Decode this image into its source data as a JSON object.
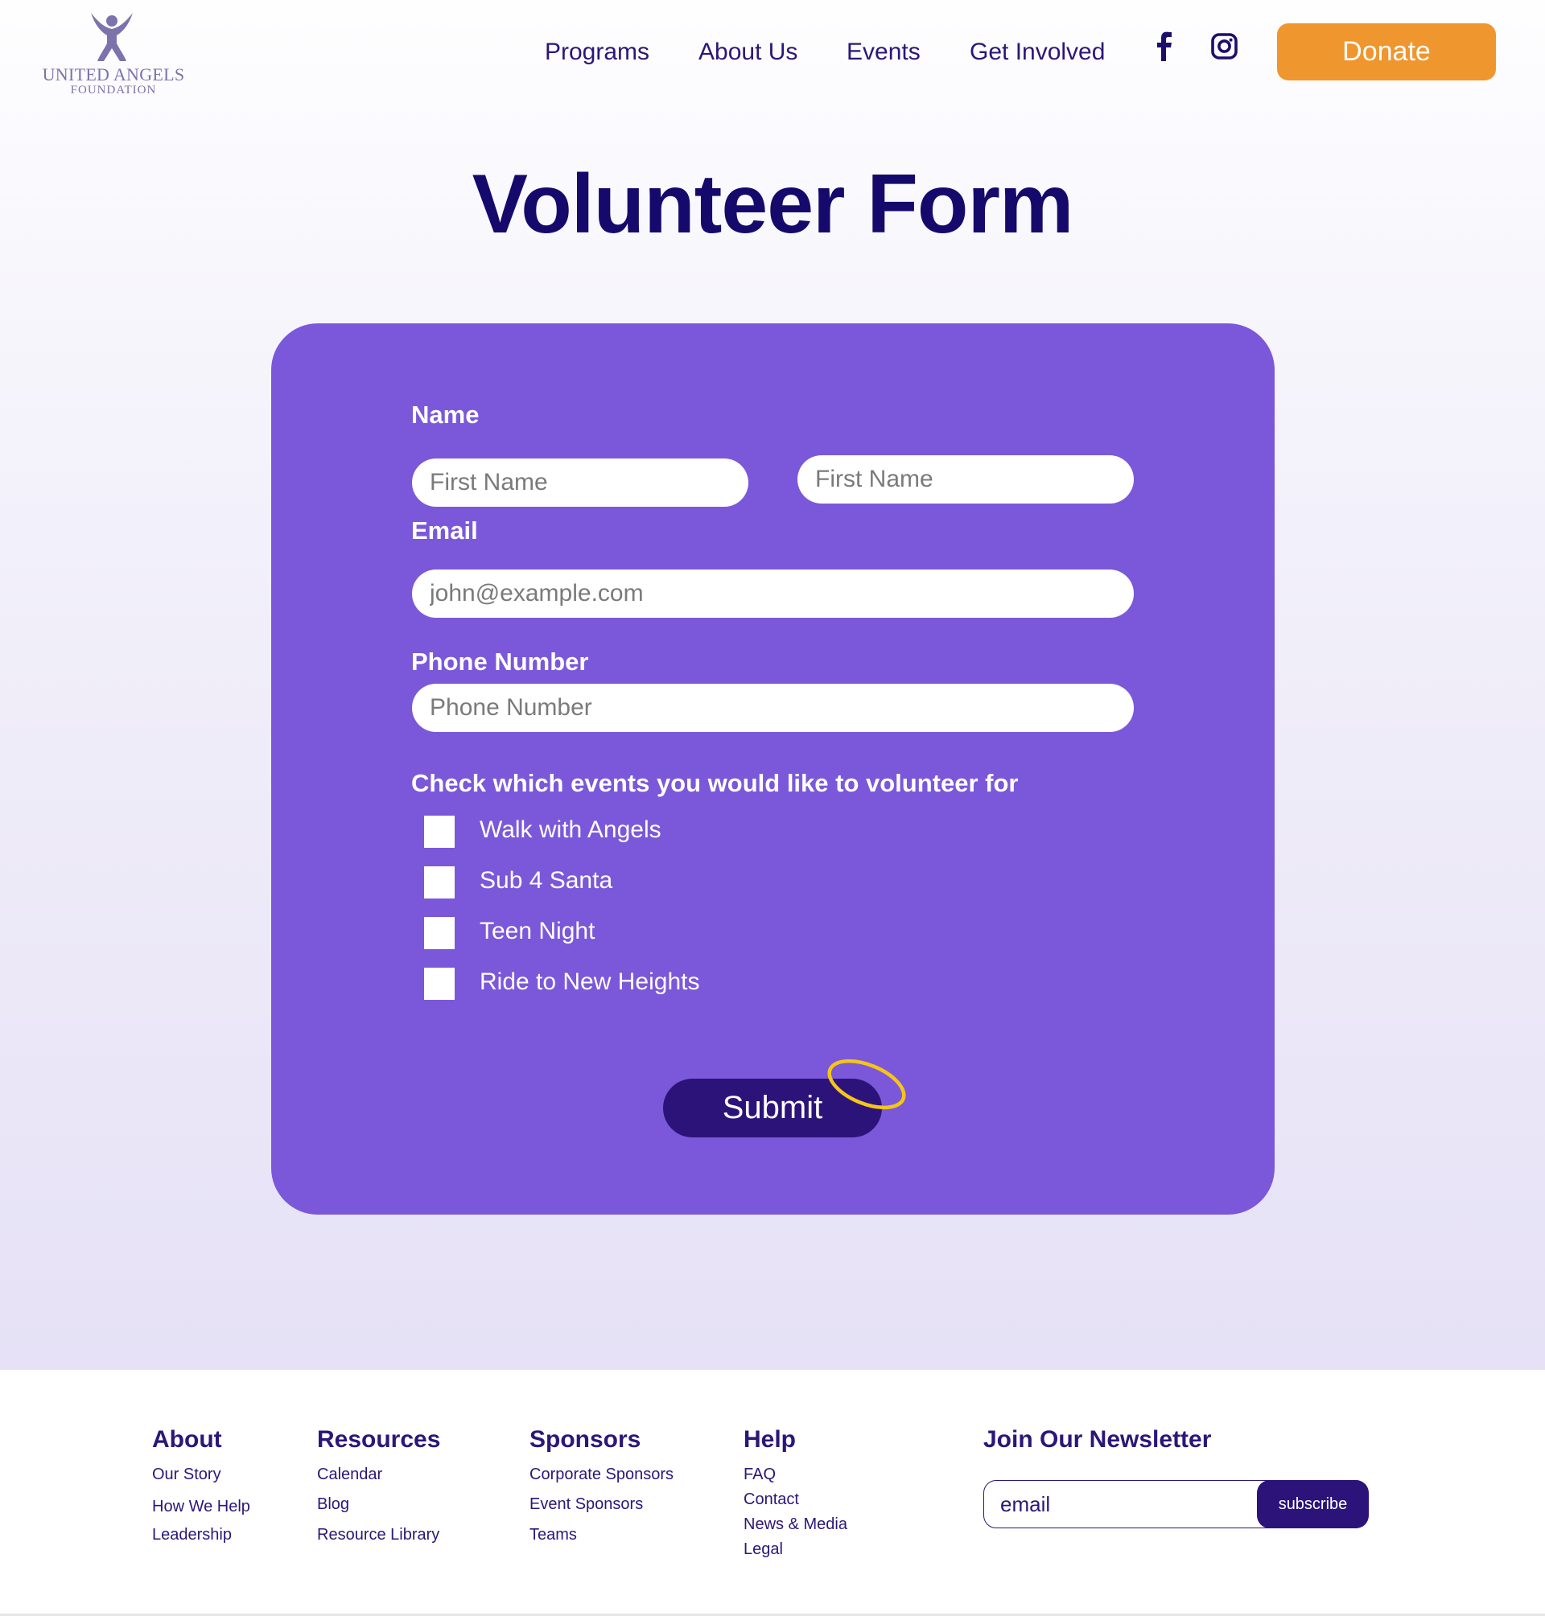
{
  "brand": {
    "name": "UNITED ANGELS",
    "subtitle": "FOUNDATION",
    "logo_icon": "angel-figure-icon",
    "logo_color": "#7c72ac"
  },
  "nav": {
    "links": [
      "Programs",
      "About Us",
      "Events",
      "Get Involved"
    ],
    "social": [
      "facebook-icon",
      "instagram-icon"
    ],
    "donate_label": "Donate"
  },
  "title": "Volunteer Form",
  "form": {
    "name_label": "Name",
    "first_name_placeholder": "First Name",
    "last_name_placeholder": "First Name",
    "email_label": "Email",
    "email_placeholder": "john@example.com",
    "phone_label": "Phone Number",
    "phone_placeholder": "Phone Number",
    "events_label": "Check which events you would like to volunteer for",
    "events": [
      {
        "label": "Walk with Angels",
        "checked": false
      },
      {
        "label": "Sub 4 Santa",
        "checked": false
      },
      {
        "label": "Teen Night",
        "checked": false
      },
      {
        "label": "Ride to New Heights",
        "checked": false
      }
    ],
    "submit_label": "Submit",
    "submit_decoration": "halo-icon"
  },
  "footer": {
    "columns": [
      {
        "heading": "About",
        "links": [
          "Our Story",
          "How We Help",
          "Leadership"
        ]
      },
      {
        "heading": "Resources",
        "links": [
          "Calendar",
          "Blog",
          "Resource Library"
        ]
      },
      {
        "heading": "Sponsors",
        "links": [
          "Corporate Sponsors",
          "Event Sponsors",
          "Teams"
        ]
      },
      {
        "heading": "Help",
        "links": [
          "FAQ",
          "Contact",
          "News & Media",
          "Legal"
        ]
      }
    ],
    "newsletter": {
      "heading": "Join Our Newsletter",
      "input_placeholder": "email",
      "button_label": "subscribe"
    }
  },
  "colors": {
    "brand_dark": "#2c137a",
    "title": "#150a6c",
    "card": "#7b58d9",
    "donate": "#ef962e",
    "halo": "#f5c518"
  }
}
